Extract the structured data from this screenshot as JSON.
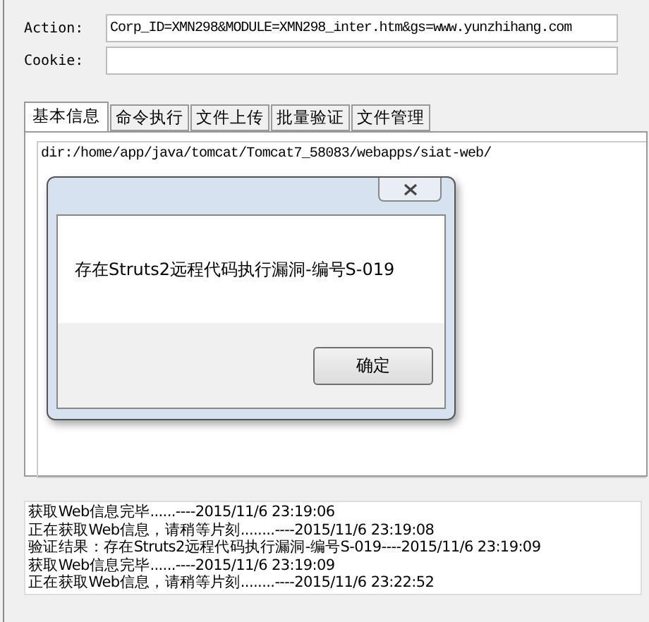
{
  "form": {
    "fields": [
      {
        "label": "Action:",
        "value": "Corp_ID=XMN298&MODULE=XMN298_inter.htm&gs=www.yunzhihang.com"
      },
      {
        "label": "Cookie:"
      }
    ]
  },
  "tabs": [
    {
      "label": "基本信息",
      "selected": true
    },
    {
      "label": "命令执行",
      "selected": false
    },
    {
      "label": "文件上传",
      "selected": false
    },
    {
      "label": "批量验证",
      "selected": false
    },
    {
      "label": "文件管理",
      "selected": false
    }
  ],
  "panel": {
    "output": "dir:/home/app/java/tomcat/Tomcat7_58083/webapps/siat-web/"
  },
  "dialog": {
    "message": "存在Struts2远程代码执行漏洞-编号S-019",
    "button": "确定"
  },
  "log": [
    "获取Web信息完毕......----2015/11/6 23:19:06",
    "正在获取Web信息，请稍等片刻........----2015/11/6 23:19:08",
    "验证结果：存在Struts2远程代码执行漏洞-编号S-019----2015/11/6 23:19:09",
    "获取Web信息完毕......----2015/11/6 23:19:09",
    "正在获取Web信息，请稍等片刻........----2015/11/6 23:22:52"
  ]
}
